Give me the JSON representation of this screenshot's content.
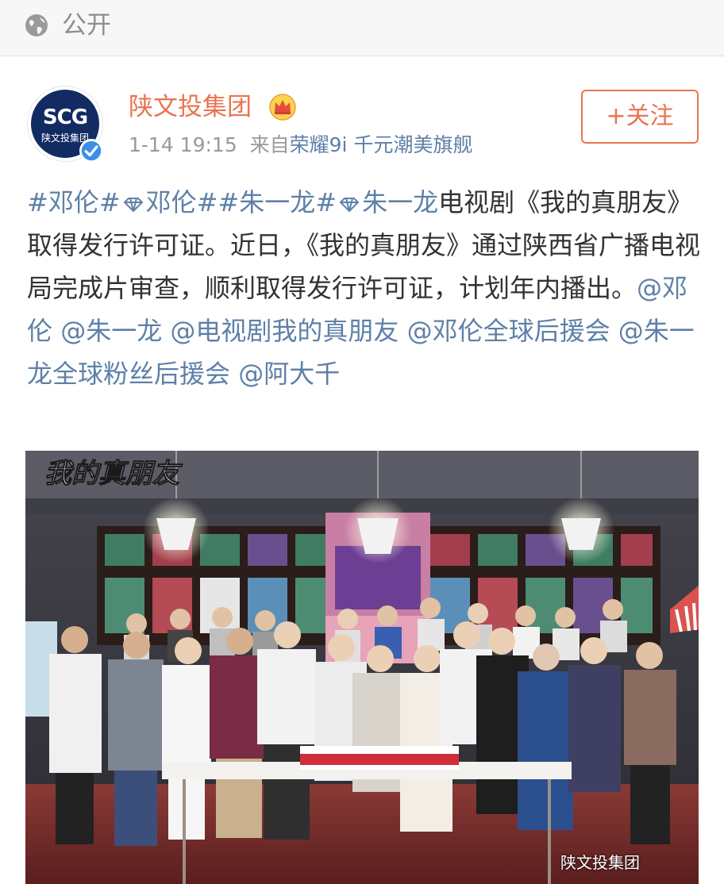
{
  "header": {
    "visibility_label": "公开"
  },
  "post": {
    "author_name": "陕文投集团",
    "avatar_logo": "SCG",
    "avatar_logo_sub": "陕文投集团",
    "time": "1-14 19:15",
    "source_prefix": "来自",
    "source_device": "荣耀9i 千元潮美旗舰",
    "follow_button": "+关注",
    "text": {
      "tag1": "#邓伦#",
      "tag2": "邓伦#",
      "tag3": "#朱一龙#",
      "tag4": "朱一龙",
      "body1": "电视剧《我的真朋友》取得发行许可证。近日，《我的真朋友》通过陕西省广播电视局完成片审查，顺利取得发行许可证，计划年内播出。",
      "mention1": "@邓伦",
      "mention2": "@朱一龙",
      "mention3": "@电视剧我的真朋友",
      "mention4": "@邓伦全球后援会",
      "mention5": "@朱一龙全球粉丝后援会",
      "mention6": "@阿大千"
    },
    "image": {
      "overlay_title": "我的真朋友",
      "watermark": "陕文投集团"
    }
  },
  "colors": {
    "accent_orange": "#eb7350",
    "link_blue": "#5e80a8",
    "meta_gray": "#999999",
    "verified_blue": "#3b8fe6"
  },
  "icons": [
    "globe-icon",
    "crown-icon",
    "verified-icon",
    "diamond-icon"
  ]
}
